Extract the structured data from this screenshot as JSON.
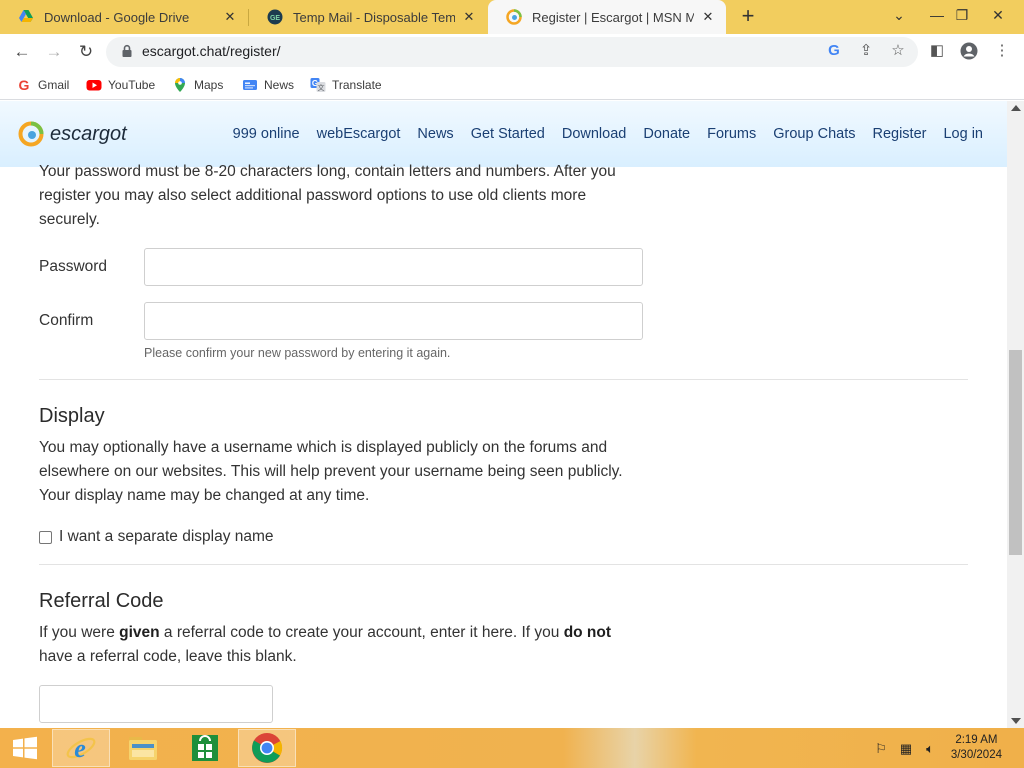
{
  "browser": {
    "tabs": [
      {
        "title": "Download - Google Drive",
        "icon": "google-drive-icon",
        "active": false
      },
      {
        "title": "Temp Mail - Disposable Tempora",
        "icon": "temp-mail-icon",
        "active": false
      },
      {
        "title": "Register | Escargot | MSN Messen",
        "icon": "escargot-icon",
        "active": true
      }
    ],
    "new_tab_label": "+",
    "url": "escargot.chat/register/",
    "bookmarks": [
      {
        "label": "Gmail",
        "icon": "gmail-icon"
      },
      {
        "label": "YouTube",
        "icon": "youtube-icon"
      },
      {
        "label": "Maps",
        "icon": "maps-icon"
      },
      {
        "label": "News",
        "icon": "news-icon"
      },
      {
        "label": "Translate",
        "icon": "translate-icon"
      }
    ],
    "colors": {
      "tabstrip": "#f2cd5e",
      "omnibox": "#f1f3f4"
    }
  },
  "site": {
    "logo_text": "escargot",
    "nav": [
      "999 online",
      "webEscargot",
      "News",
      "Get Started",
      "Download",
      "Donate",
      "Forums",
      "Group Chats",
      "Register",
      "Log in"
    ],
    "colors": {
      "header_top": "#f1f9ff",
      "header_bottom": "#d9efff",
      "nav_link": "#1a3f73"
    }
  },
  "form": {
    "password_intro": "Your password must be 8-20 characters long, contain letters and numbers. After you register you may also select additional password options to use old clients more securely.",
    "password_label": "Password",
    "password_value": "",
    "confirm_label": "Confirm",
    "confirm_value": "",
    "confirm_hint": "Please confirm your new password by entering it again.",
    "display": {
      "heading": "Display",
      "description": "You may optionally have a username which is displayed publicly on the forums and elsewhere on our websites. This will help prevent your username being seen publicly. Your display name may be changed at any time.",
      "checkbox_label": "I want a separate display name",
      "checked": false
    },
    "referral": {
      "heading": "Referral Code",
      "desc_part1": "If you were ",
      "desc_bold1": "given",
      "desc_part2": " a referral code to create your account, enter it here. If you ",
      "desc_bold2": "do not",
      "desc_part3": " have a referral code, leave this blank.",
      "value": ""
    }
  },
  "taskbar": {
    "apps": [
      {
        "name": "internet-explorer",
        "icon": "ie-icon",
        "active": true
      },
      {
        "name": "file-explorer",
        "icon": "folder-icon",
        "active": false
      },
      {
        "name": "windows-store",
        "icon": "store-icon",
        "active": false
      },
      {
        "name": "google-chrome",
        "icon": "chrome-icon",
        "active": true
      }
    ],
    "clock_time": "2:19 AM",
    "clock_date": "3/30/2024"
  }
}
